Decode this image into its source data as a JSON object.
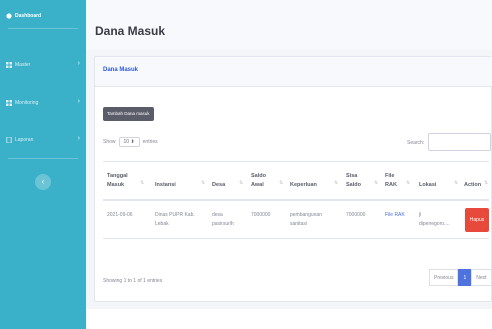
{
  "sidebar": {
    "items": [
      {
        "label": "Dashboard"
      },
      {
        "label": "Master"
      },
      {
        "label": "Monitoring"
      },
      {
        "label": "Laporan"
      }
    ],
    "toggle_glyph": "‹"
  },
  "header": {
    "title": "Dana Masuk"
  },
  "card": {
    "header": "Dana Masuk",
    "add_button": "Tambah Dana masuk",
    "show_prefix": "Show",
    "show_value": "10 ⬍",
    "show_suffix": "entries",
    "search_label": "Search:",
    "search_value": ""
  },
  "table": {
    "headers": [
      {
        "line1": "Tanggal",
        "line2": "Masuk"
      },
      {
        "line1": "Instansi",
        "line2": ""
      },
      {
        "line1": "Desa",
        "line2": ""
      },
      {
        "line1": "Saldo",
        "line2": "Awal"
      },
      {
        "line1": "Keperluan",
        "line2": ""
      },
      {
        "line1": "Sisa",
        "line2": "Saldo"
      },
      {
        "line1": "File",
        "line2": "RAK"
      },
      {
        "line1": "Lokasi",
        "line2": ""
      },
      {
        "line1": "Action",
        "line2": ""
      }
    ],
    "rows": [
      {
        "tanggal": "2021-09-06",
        "instansi_1": "Dinas PUPR Kab.",
        "instansi_2": "Lebak",
        "desa_1": "desa",
        "desa_2": "pasirsurih",
        "saldo_awal": "7000000",
        "keperluan_1": "pembangunan",
        "keperluan_2": "sanitasi",
        "sisa_saldo": "7000000",
        "file": "File RAK",
        "lokasi_1": "jl",
        "lokasi_2": "dipenegoro....",
        "action": "Hapus"
      }
    ]
  },
  "footer": {
    "info": "Showing 1 to 1 of 1 entries",
    "previous": "Previous",
    "page": "1",
    "next": "Next"
  },
  "colors": {
    "sidebar": "#3ab0c9",
    "primary": "#4e73df",
    "danger": "#e74a3b",
    "dark_button": "#5a5c69"
  }
}
